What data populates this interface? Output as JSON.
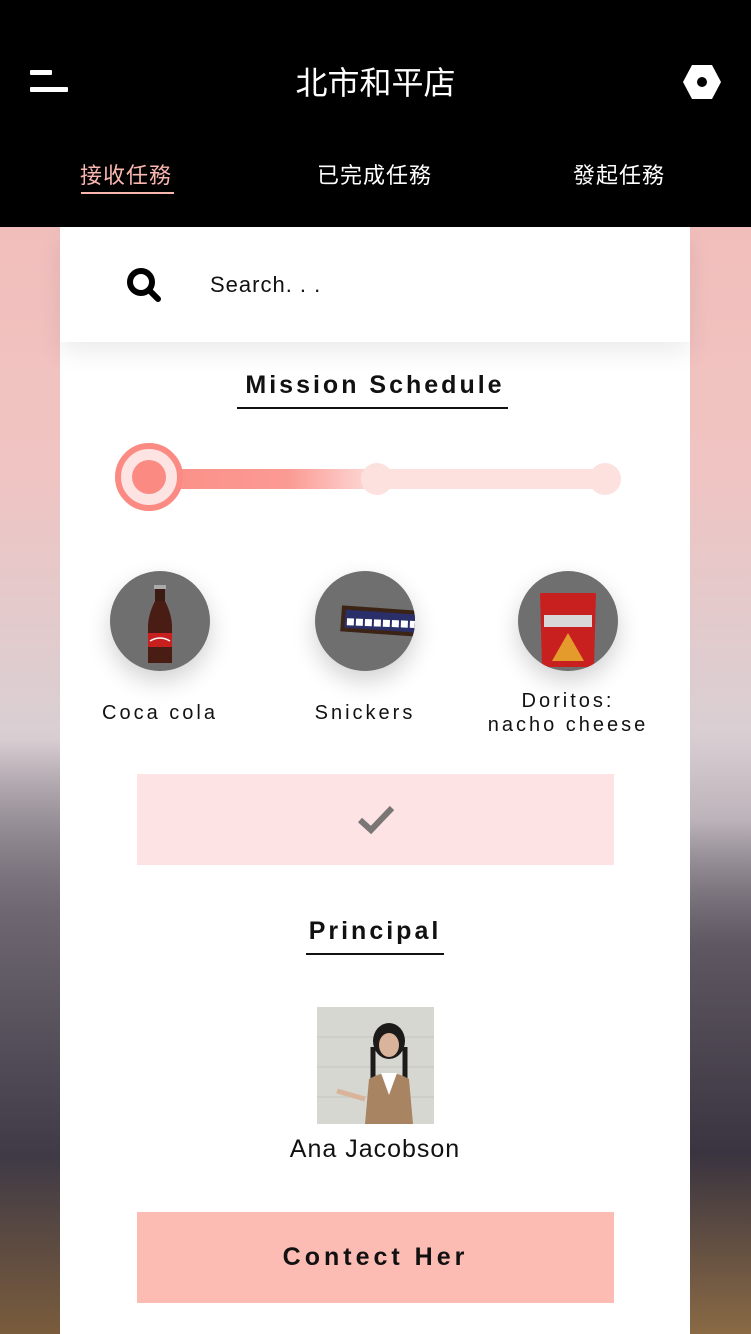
{
  "header": {
    "title": "北市和平店",
    "menu_icon": "menu-icon",
    "settings_icon": "settings-icon"
  },
  "tabs": [
    {
      "label": "接收任務",
      "active": true
    },
    {
      "label": "已完成任務",
      "active": false
    },
    {
      "label": "發起任務",
      "active": false
    }
  ],
  "search": {
    "placeholder": "Search. . .",
    "icon": "search-icon"
  },
  "mission": {
    "title": "Mission Schedule",
    "progress_step": 1,
    "total_steps": 3,
    "items": [
      {
        "label": "Coca cola",
        "icon": "coca-cola-bottle"
      },
      {
        "label": "Snickers",
        "icon": "snickers-bar"
      },
      {
        "label": "Doritos:\nnacho cheese",
        "icon": "doritos-bag"
      }
    ],
    "confirm_icon": "check-icon"
  },
  "principal": {
    "title": "Principal",
    "name": "Ana Jacobson",
    "contact_label": "Contect Her"
  },
  "colors": {
    "accent": "#fb8a82",
    "accent_light": "#fde1df",
    "button": "#fcbcb4",
    "header_bg": "#000000"
  }
}
